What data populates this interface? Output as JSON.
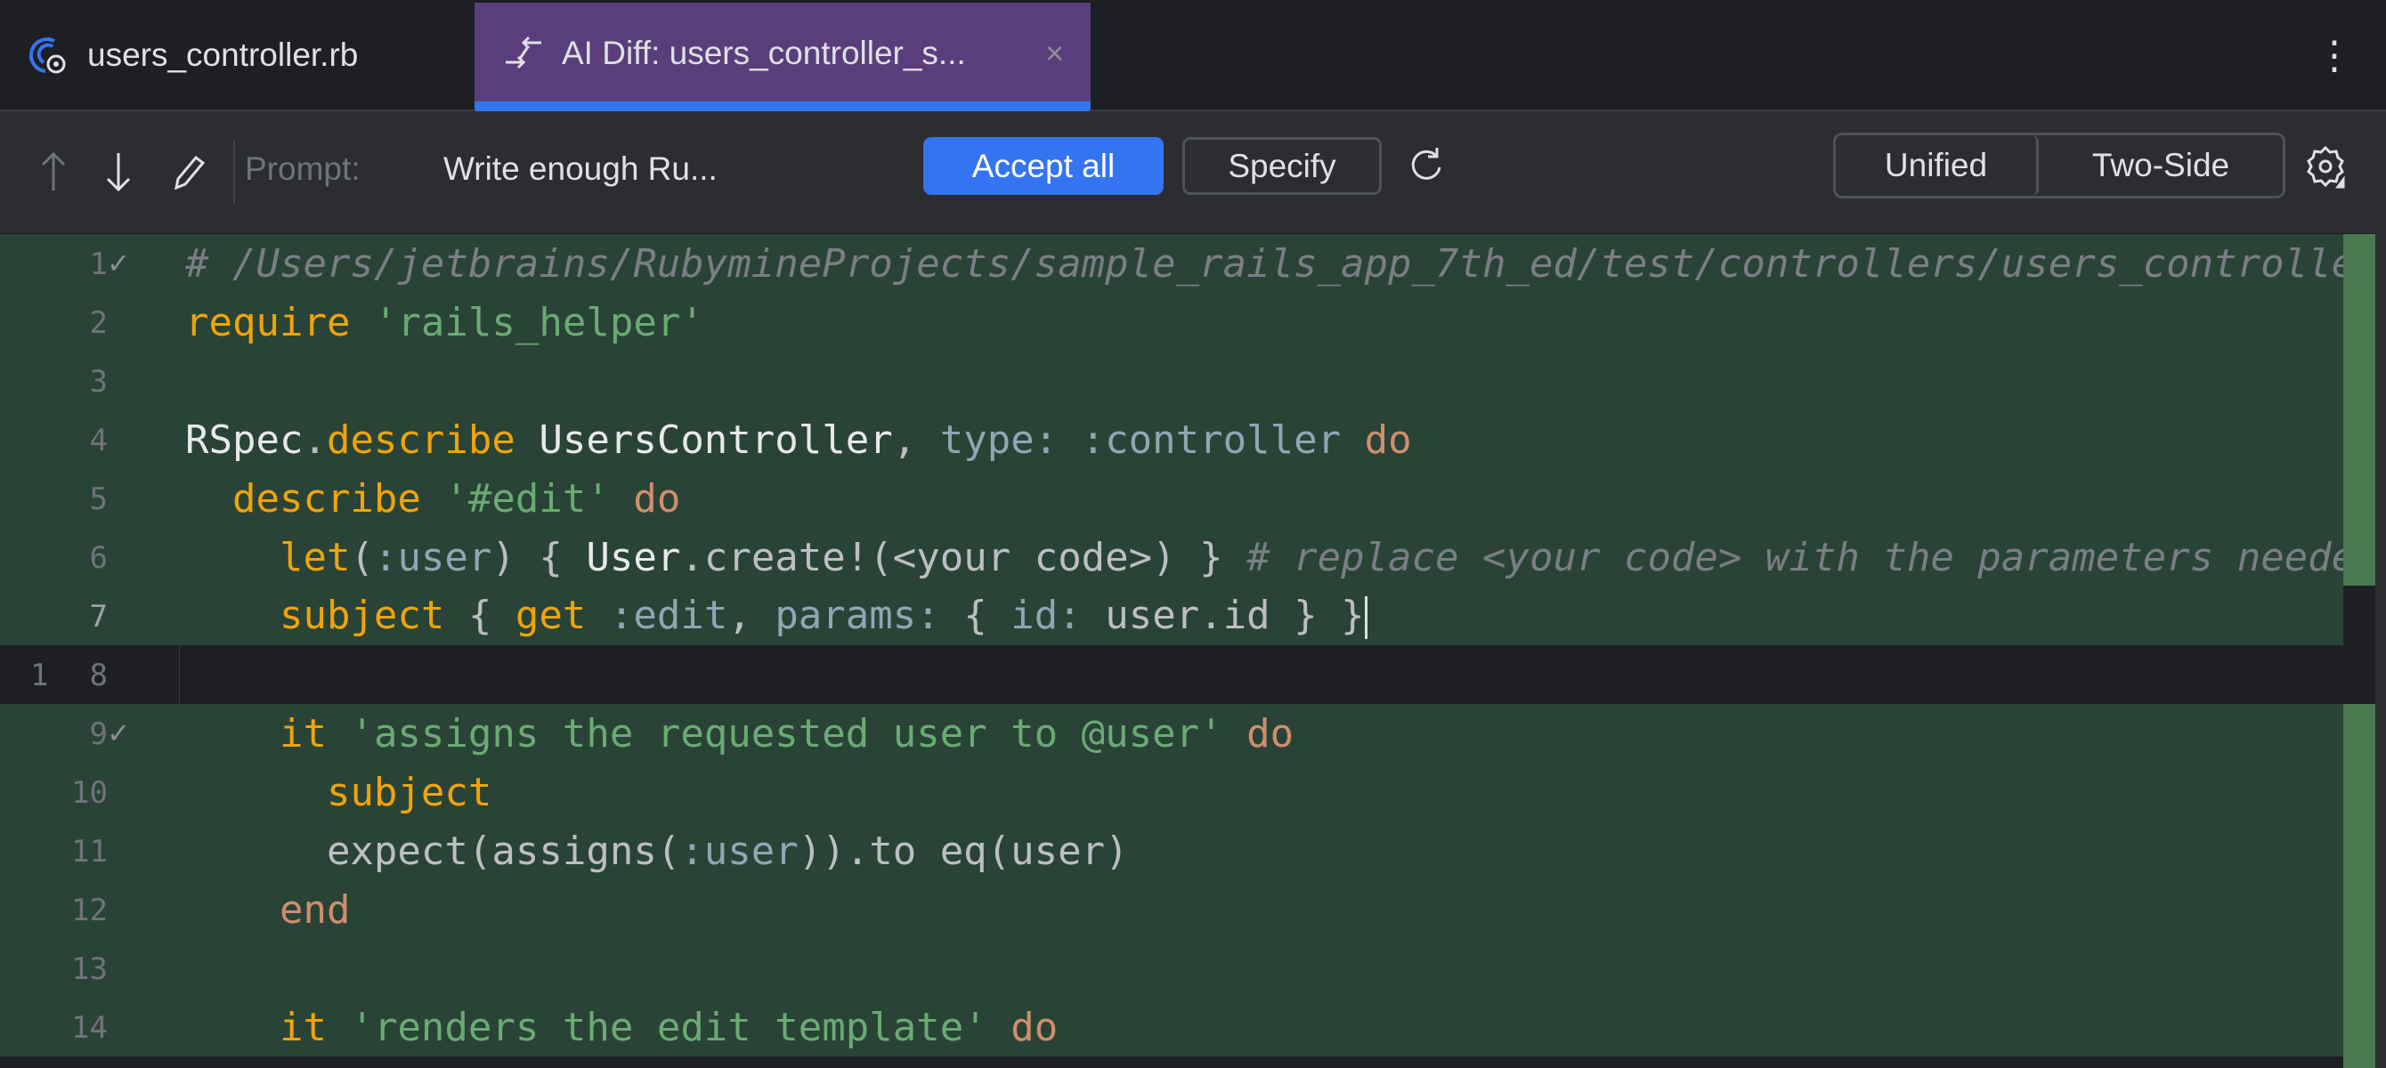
{
  "tabs": [
    {
      "label": "users_controller.rb",
      "icon": "ruby-gear-icon"
    },
    {
      "label": "AI Diff: users_controller_s...",
      "icon": "diff-arrows-icon",
      "close": "×",
      "active": true
    }
  ],
  "toolbar": {
    "prompt_label": "Prompt:",
    "prompt_value": "Write enough Ru...",
    "accept_all": "Accept all",
    "specify": "Specify",
    "view_unified": "Unified",
    "view_two_side": "Two-Side"
  },
  "colors": {
    "accent": "#3574f0",
    "tab_active": "#5a3e7b",
    "added_bg": "#294436"
  },
  "lines": [
    {
      "old": "",
      "new": "1",
      "check": "✓",
      "added": true,
      "tokens": [
        [
          "c",
          "# /Users/jetbrains/RubymineProjects/sample_rails_app_7th_ed/test/controllers/users_controller_spec.rb"
        ]
      ]
    },
    {
      "old": "",
      "new": "2",
      "added": true,
      "tokens": [
        [
          "k",
          "require"
        ],
        [
          "p",
          " "
        ],
        [
          "s",
          "'rails_helper'"
        ]
      ]
    },
    {
      "old": "",
      "new": "3",
      "added": true,
      "tokens": []
    },
    {
      "old": "",
      "new": "4",
      "added": true,
      "tokens": [
        [
          "w",
          "RSpec"
        ],
        [
          "p",
          "."
        ],
        [
          "k",
          "describe"
        ],
        [
          "p",
          " "
        ],
        [
          "w",
          "UsersController"
        ],
        [
          "p",
          ", "
        ],
        [
          "y",
          "type:"
        ],
        [
          "p",
          " "
        ],
        [
          "y",
          ":controller"
        ],
        [
          "p",
          " "
        ],
        [
          "d",
          "do"
        ]
      ]
    },
    {
      "old": "",
      "new": "5",
      "added": true,
      "tokens": [
        [
          "p",
          "  "
        ],
        [
          "k",
          "describe"
        ],
        [
          "p",
          " "
        ],
        [
          "s",
          "'#edit'"
        ],
        [
          "p",
          " "
        ],
        [
          "d",
          "do"
        ]
      ]
    },
    {
      "old": "",
      "new": "6",
      "added": true,
      "tokens": [
        [
          "p",
          "    "
        ],
        [
          "k",
          "let"
        ],
        [
          "p",
          "("
        ],
        [
          "y",
          ":user"
        ],
        [
          "p",
          ") { "
        ],
        [
          "w",
          "User"
        ],
        [
          "p",
          ".create!(<your code>) } "
        ],
        [
          "c",
          "# replace <your code> with the parameters needed to create a user"
        ]
      ]
    },
    {
      "old": "",
      "new": "7",
      "current": true,
      "added": true,
      "caret": true,
      "tokens": [
        [
          "p",
          "    "
        ],
        [
          "k",
          "subject"
        ],
        [
          "p",
          " { "
        ],
        [
          "k",
          "get"
        ],
        [
          "p",
          " "
        ],
        [
          "y",
          ":edit"
        ],
        [
          "p",
          ", "
        ],
        [
          "y",
          "params:"
        ],
        [
          "p",
          " { "
        ],
        [
          "y",
          "id:"
        ],
        [
          "p",
          " user.id } }"
        ]
      ]
    },
    {
      "old": "1",
      "new": "8",
      "added": false,
      "tokens": []
    },
    {
      "old": "",
      "new": "9",
      "check": "✓",
      "added": true,
      "tokens": [
        [
          "p",
          "    "
        ],
        [
          "k",
          "it"
        ],
        [
          "p",
          " "
        ],
        [
          "s",
          "'assigns the requested user to @user'"
        ],
        [
          "p",
          " "
        ],
        [
          "d",
          "do"
        ]
      ]
    },
    {
      "old": "",
      "new": "10",
      "added": true,
      "tokens": [
        [
          "p",
          "      "
        ],
        [
          "k",
          "subject"
        ]
      ]
    },
    {
      "old": "",
      "new": "11",
      "added": true,
      "tokens": [
        [
          "p",
          "      expect(assigns("
        ],
        [
          "y",
          ":user"
        ],
        [
          "p",
          ")).to eq(user)"
        ]
      ]
    },
    {
      "old": "",
      "new": "12",
      "added": true,
      "tokens": [
        [
          "p",
          "    "
        ],
        [
          "d",
          "end"
        ]
      ]
    },
    {
      "old": "",
      "new": "13",
      "added": true,
      "tokens": []
    },
    {
      "old": "",
      "new": "14",
      "added": true,
      "tokens": [
        [
          "p",
          "    "
        ],
        [
          "k",
          "it"
        ],
        [
          "p",
          " "
        ],
        [
          "s",
          "'renders the edit template'"
        ],
        [
          "p",
          " "
        ],
        [
          "d",
          "do"
        ]
      ]
    }
  ]
}
